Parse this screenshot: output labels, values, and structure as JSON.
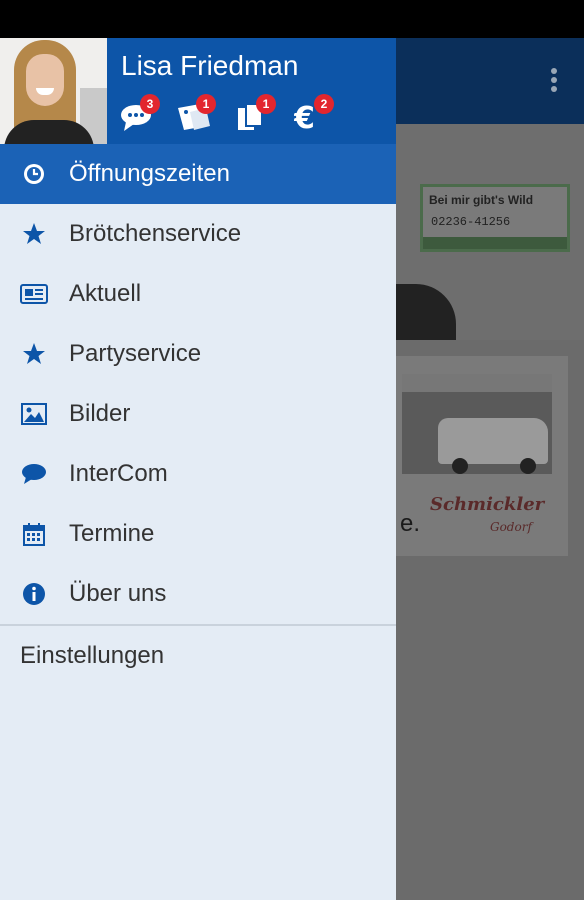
{
  "user": {
    "name": "Lisa Friedman"
  },
  "badges": [
    {
      "icon": "chat-icon",
      "count": "3"
    },
    {
      "icon": "coupon-icon",
      "count": "1"
    },
    {
      "icon": "documents-icon",
      "count": "1"
    },
    {
      "icon": "euro-icon",
      "count": "2"
    }
  ],
  "menu": {
    "items": [
      {
        "label": "Öffnungszeiten",
        "icon": "clock-icon",
        "active": true
      },
      {
        "label": "Brötchenservice",
        "icon": "star-icon"
      },
      {
        "label": "Aktuell",
        "icon": "newspaper-icon"
      },
      {
        "label": "Partyservice",
        "icon": "star-icon"
      },
      {
        "label": "Bilder",
        "icon": "image-icon"
      },
      {
        "label": "InterCom",
        "icon": "speech-bubble-icon"
      },
      {
        "label": "Termine",
        "icon": "calendar-icon"
      },
      {
        "label": "Über uns",
        "icon": "info-icon"
      }
    ],
    "settings_label": "Einstellungen"
  },
  "background": {
    "sign_line1": "Bei mir gibt's Wild",
    "sign_line2": "02236-41256",
    "card_text": "e.",
    "logo_text": "Schmickler",
    "logo_subtext": "Godorf"
  },
  "colors": {
    "drawer_header": "#0d55a8",
    "active_item": "#1b62b6",
    "drawer_bg": "#e4ecf5",
    "badge": "#e2262e"
  }
}
